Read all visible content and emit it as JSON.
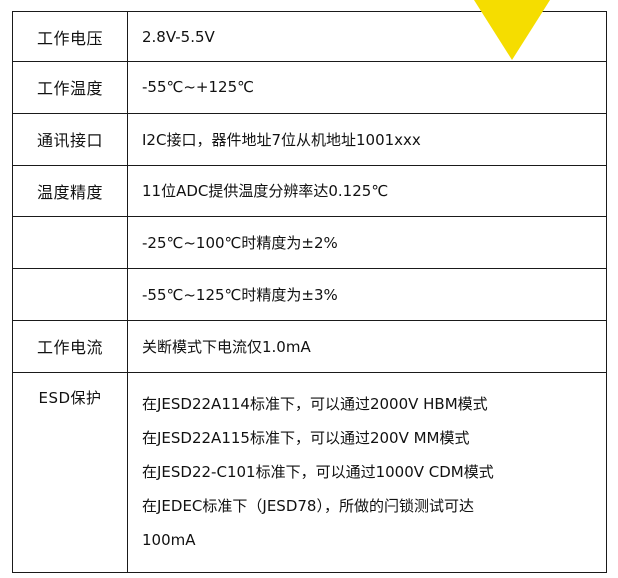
{
  "colors": {
    "background": "#ffffff",
    "border": "#1a1a1a",
    "text": "#111111",
    "corner_marker": "#f5dd00"
  },
  "rows": [
    {
      "label": "工作电压",
      "value": "2.8V-5.5V"
    },
    {
      "label": "工作温度",
      "value": "-55℃~+125℃"
    },
    {
      "label": "通讯接口",
      "value": "I2C接口，器件地址7位从机地址1001xxx"
    },
    {
      "label": "温度精度",
      "value": "11位ADC提供温度分辨率达0.125℃"
    },
    {
      "label": "",
      "value": "-25℃~100℃时精度为±2%"
    },
    {
      "label": "",
      "value": "-55℃~125℃时精度为±3%"
    },
    {
      "label": "工作电流",
      "value": "关断模式下电流仅1.0mA"
    }
  ],
  "esd": {
    "label": "ESD保护",
    "lines": [
      "在JESD22A114标准下，可以通过2000V HBM模式",
      "在JESD22A115标准下，可以通过200V MM模式",
      "在JESD22-C101标准下，可以通过1000V CDM模式",
      "在JEDEC标准下（JESD78），所做的闩锁测试可达",
      "100mA"
    ]
  }
}
